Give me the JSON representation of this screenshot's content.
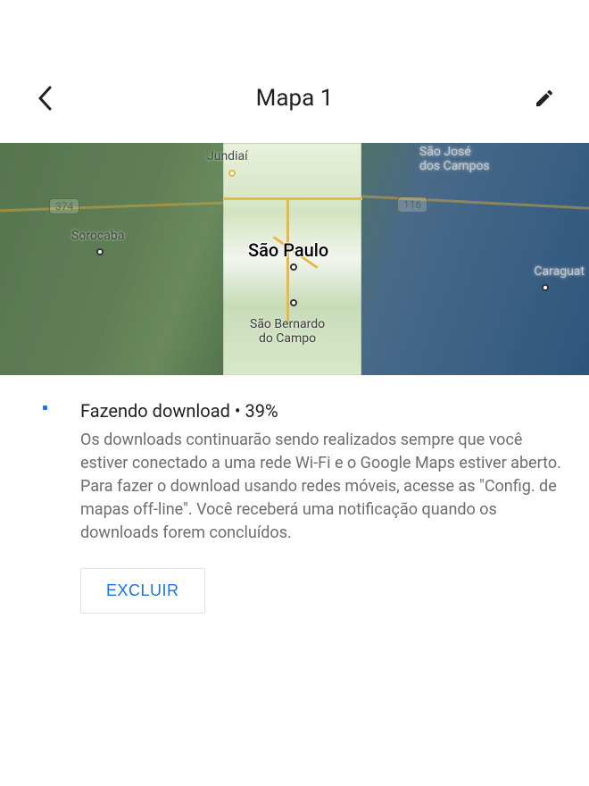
{
  "header": {
    "title": "Mapa 1"
  },
  "map": {
    "main_city": "São Paulo",
    "cities": {
      "jundiai": "Jundiaí",
      "sorocaba": "Sorocaba",
      "sao_jose": "São José\ndos Campos",
      "caraguat": "Caraguat",
      "sao_bernardo": "São Bernardo\ndo Campo"
    },
    "roads": {
      "r374": "374",
      "r116": "116"
    }
  },
  "status": {
    "label": "Fazendo download",
    "separator": "•",
    "percent": "39%",
    "description": "Os downloads continuarão sendo realizados sempre que você estiver conectado a uma rede Wi-Fi e o Google Maps estiver aberto. Para fazer o download usando redes móveis, acesse as \"Config. de mapas off-line\". Você receberá uma notificação quando os downloads forem concluídos."
  },
  "actions": {
    "delete_label": "EXCLUIR"
  }
}
